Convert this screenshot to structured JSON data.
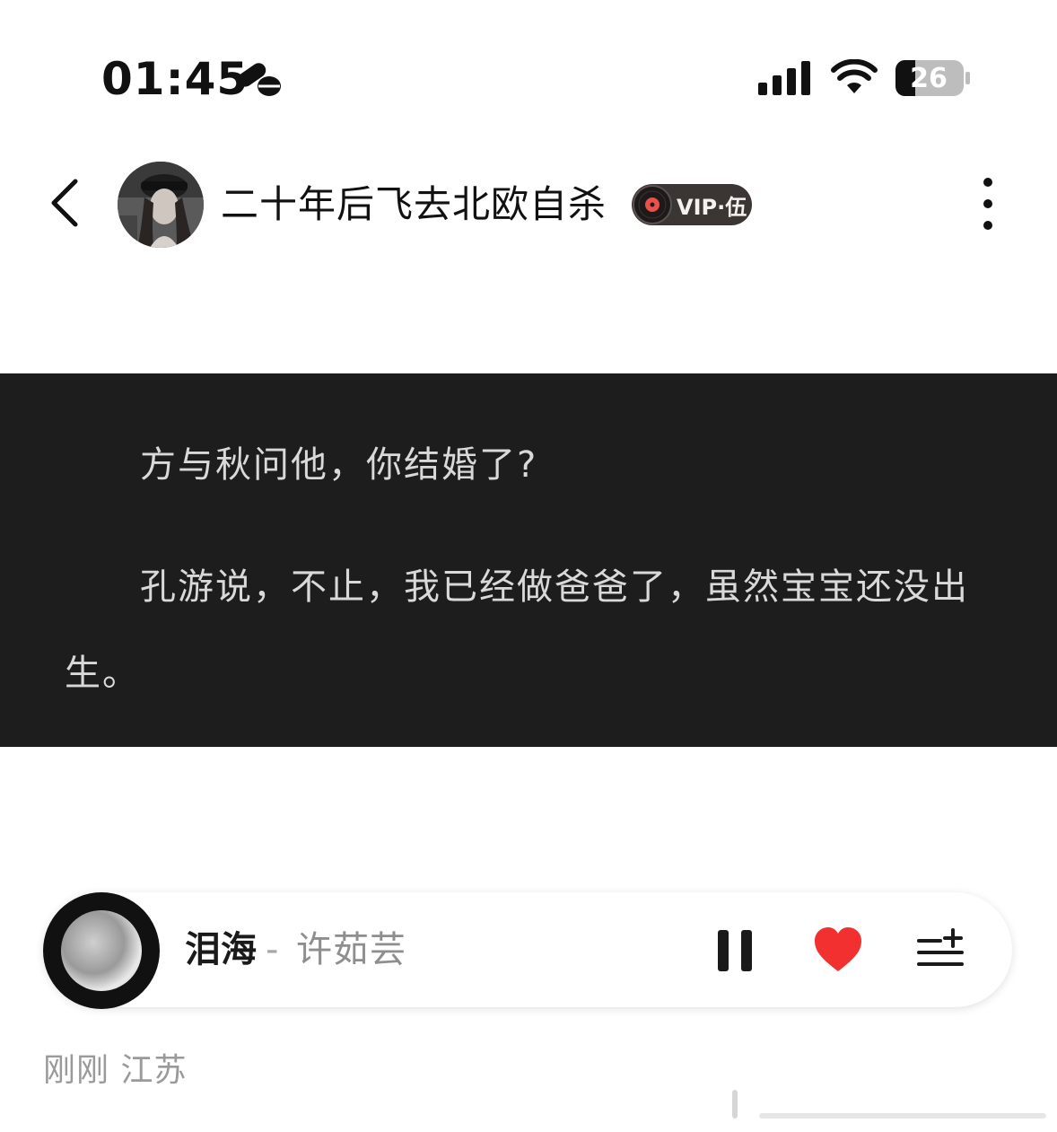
{
  "status_bar": {
    "time": "01:45",
    "battery": "26"
  },
  "header": {
    "username": "二十年后飞去北欧自杀",
    "vip_label": "VIP·伍"
  },
  "content": {
    "lines": [
      "方与秋问他，你结婚了?",
      "孔游说，不止，我已经做爸爸了，虽然宝宝还没出",
      "生。"
    ]
  },
  "player": {
    "song_title": "泪海",
    "separator": "-",
    "artist": "许茹芸"
  },
  "footer": {
    "meta": "刚刚 江苏"
  },
  "colors": {
    "panel_background": "#1d1d1d",
    "heart": "#f2302f",
    "vip_badge": "#3b3534"
  }
}
